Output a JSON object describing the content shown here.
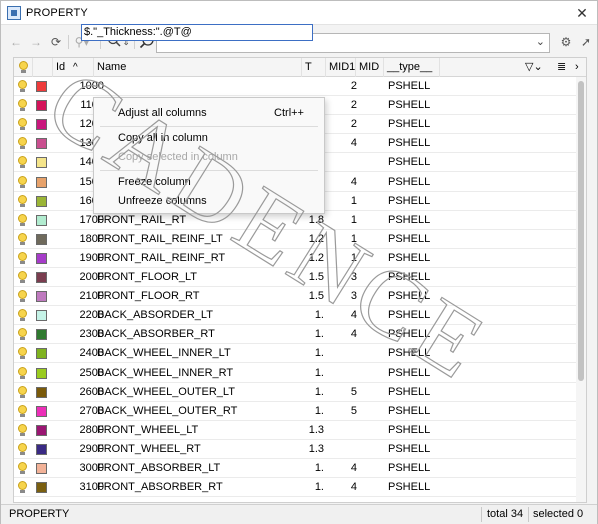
{
  "window": {
    "title": "PROPERTY"
  },
  "toolbar": {
    "search_value": "",
    "search_placeholder": ""
  },
  "table": {
    "headers": {
      "visible": "",
      "color": "",
      "id": "Id",
      "name": "Name",
      "t": "T",
      "mid1": "MID1",
      "mid": "MID",
      "type": "__type__"
    },
    "editing_value": "$.\"_Thickness:\".@T@",
    "rows": [
      {
        "id": "1000",
        "name": "",
        "t": "",
        "mid1": "2",
        "type": "PSHELL",
        "color": "#ee3b3b"
      },
      {
        "id": "1100",
        "name": "",
        "t": "",
        "mid1": "2",
        "type": "PSHELL",
        "color": "#d4145a"
      },
      {
        "id": "1200",
        "name": "",
        "t": "",
        "mid1": "2",
        "type": "PSHELL",
        "color": "#c9177d"
      },
      {
        "id": "1300",
        "name": "",
        "t": "",
        "mid1": "4",
        "type": "PSHELL",
        "color": "#c94f8f"
      },
      {
        "id": "1400",
        "name": "",
        "t": "",
        "mid1": "",
        "type": "PSHELL",
        "color": "#f4e48a"
      },
      {
        "id": "1500",
        "name": "",
        "t": "",
        "mid1": "4",
        "type": "PSHELL",
        "color": "#e7a26b"
      },
      {
        "id": "1600",
        "name": "",
        "t": "",
        "mid1": "1",
        "type": "PSHELL",
        "color": "#9bb536"
      },
      {
        "id": "1700",
        "name": "FRONT_RAIL_RT",
        "t": "1.8",
        "mid1": "1",
        "type": "PSHELL",
        "color": "#b2ecd0"
      },
      {
        "id": "1800",
        "name": "FRONT_RAIL_REINF_LT",
        "t": "1.2",
        "mid1": "1",
        "type": "PSHELL",
        "color": "#6f6a5c"
      },
      {
        "id": "1900",
        "name": "FRONT_RAIL_REINF_RT",
        "t": "1.2",
        "mid1": "1",
        "type": "PSHELL",
        "color": "#a63cc9"
      },
      {
        "id": "2000",
        "name": "FRONT_FLOOR_LT",
        "t": "1.5",
        "mid1": "3",
        "type": "PSHELL",
        "color": "#7a3d4f"
      },
      {
        "id": "2100",
        "name": "FRONT_FLOOR_RT",
        "t": "1.5",
        "mid1": "3",
        "type": "PSHELL",
        "color": "#bf7abf"
      },
      {
        "id": "2200",
        "name": "BACK_ABSORDER_LT",
        "t": "1.",
        "mid1": "4",
        "type": "PSHELL",
        "color": "#c5f3e7"
      },
      {
        "id": "2300",
        "name": "BACK_ABSORBER_RT",
        "t": "1.",
        "mid1": "4",
        "type": "PSHELL",
        "color": "#2f7a2f"
      },
      {
        "id": "2400",
        "name": "BACK_WHEEL_INNER_LT",
        "t": "1.",
        "mid1": "",
        "type": "PSHELL",
        "color": "#7fb21f"
      },
      {
        "id": "2500",
        "name": "BACK_WHEEL_INNER_RT",
        "t": "1.",
        "mid1": "",
        "type": "PSHELL",
        "color": "#9acb1f"
      },
      {
        "id": "2600",
        "name": "BACK_WHEEL_OUTER_LT",
        "t": "1.",
        "mid1": "5",
        "type": "PSHELL",
        "color": "#7a5a0a"
      },
      {
        "id": "2700",
        "name": "BACK_WHEEL_OUTER_RT",
        "t": "1.",
        "mid1": "5",
        "type": "PSHELL",
        "color": "#ec2fb8"
      },
      {
        "id": "2800",
        "name": "FRONT_WHEEL_LT",
        "t": "1.3",
        "mid1": "",
        "type": "PSHELL",
        "color": "#9a1672"
      },
      {
        "id": "2900",
        "name": "FRONT_WHEEL_RT",
        "t": "1.3",
        "mid1": "",
        "type": "PSHELL",
        "color": "#3a2a84"
      },
      {
        "id": "3000",
        "name": "FRONT_ABSORBER_LT",
        "t": "1.",
        "mid1": "4",
        "type": "PSHELL",
        "color": "#f2b298"
      },
      {
        "id": "3100",
        "name": "FRONT_ABSORBER_RT",
        "t": "1.",
        "mid1": "4",
        "type": "PSHELL",
        "color": "#7a5f10"
      }
    ]
  },
  "context_menu": {
    "adjust_all": "Adjust all columns",
    "adjust_shortcut": "Ctrl++",
    "copy_all": "Copy all in column",
    "copy_selected": "Copy selected in column",
    "freeze": "Freeze column",
    "unfreeze": "Unfreeze columns"
  },
  "status": {
    "left_label": "PROPERTY",
    "total": "total 34",
    "selected": "selected 0"
  },
  "watermark": {
    "text": "CADENCE"
  }
}
